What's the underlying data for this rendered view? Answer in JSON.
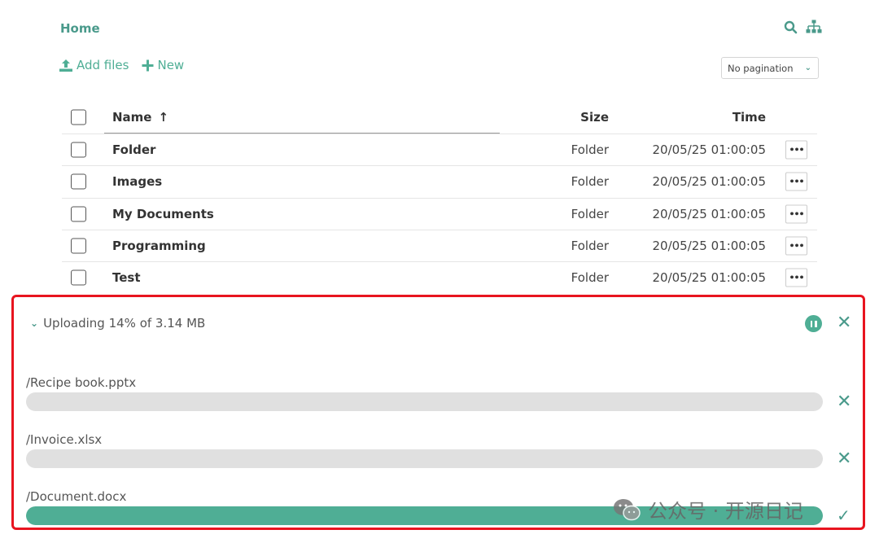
{
  "breadcrumb": {
    "home": "Home"
  },
  "toolbar": {
    "add_files": "Add files",
    "new": "New"
  },
  "pagination": {
    "selected": "No pagination"
  },
  "table": {
    "headers": {
      "name": "Name",
      "size": "Size",
      "time": "Time"
    },
    "rows": [
      {
        "name": "Folder",
        "size": "Folder",
        "time": "20/05/25 01:00:05"
      },
      {
        "name": "Images",
        "size": "Folder",
        "time": "20/05/25 01:00:05"
      },
      {
        "name": "My Documents",
        "size": "Folder",
        "time": "20/05/25 01:00:05"
      },
      {
        "name": "Programming",
        "size": "Folder",
        "time": "20/05/25 01:00:05"
      },
      {
        "name": "Test",
        "size": "Folder",
        "time": "20/05/25 01:00:05"
      }
    ],
    "more_label": "•••"
  },
  "upload": {
    "status": "Uploading 14% of 3.14 MB",
    "files": [
      {
        "path": "/Recipe book.pptx",
        "progress": 0
      },
      {
        "path": "/Invoice.xlsx",
        "progress": 0
      },
      {
        "path": "/Document.docx",
        "progress": 1.0
      }
    ]
  },
  "watermark": {
    "text": "公众号 · 开源日记"
  },
  "colors": {
    "accent": "#4fae95",
    "accent_dark": "#4a9a8b",
    "highlight_border": "#e8141f",
    "track": "#e0e0e0"
  },
  "icons": [
    "search-icon",
    "sitemap-icon",
    "upload-icon",
    "plus-icon",
    "chevron-down-icon",
    "sort-up-icon",
    "more-icon",
    "pause-icon",
    "close-icon",
    "check-icon",
    "wechat-icon"
  ]
}
